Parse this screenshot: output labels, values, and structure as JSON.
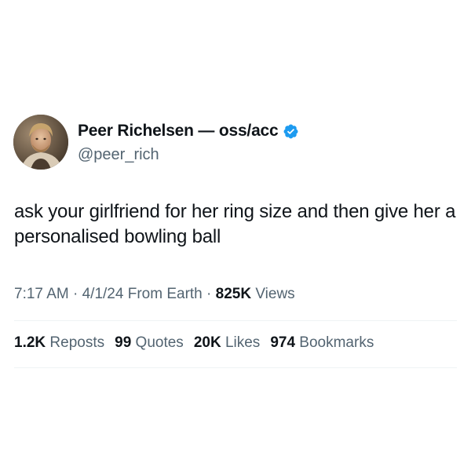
{
  "author": {
    "display_name": "Peer Richelsen — oss/acc",
    "handle": "@peer_rich",
    "verified": true,
    "verified_color": "#1d9bf0",
    "avatar_icon": "profile-photo"
  },
  "tweet": {
    "text": "ask your girlfriend for her ring size and then give her a personalised bowling ball"
  },
  "meta": {
    "time": "7:17 AM",
    "date": "4/1/24",
    "location": "From Earth",
    "views_count": "825K",
    "views_label": "Views",
    "separator": "·"
  },
  "stats": {
    "reposts_count": "1.2K",
    "reposts_label": "Reposts",
    "quotes_count": "99",
    "quotes_label": "Quotes",
    "likes_count": "20K",
    "likes_label": "Likes",
    "bookmarks_count": "974",
    "bookmarks_label": "Bookmarks"
  }
}
